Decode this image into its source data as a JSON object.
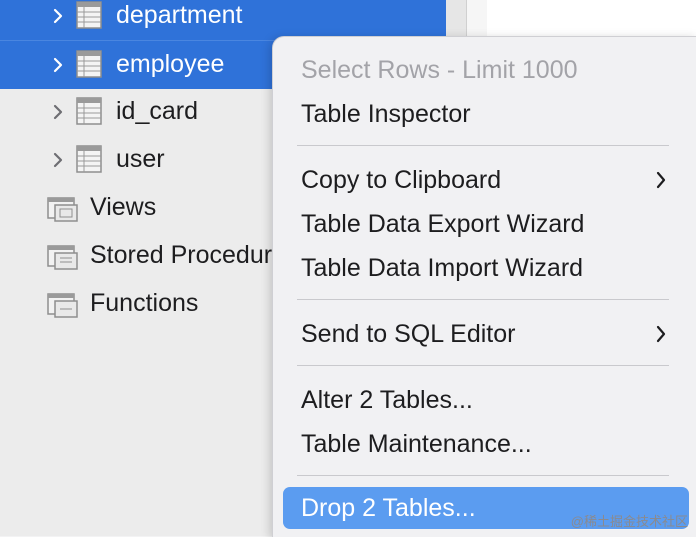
{
  "sidebar": {
    "tables": [
      {
        "label": "department",
        "selected": true
      },
      {
        "label": "employee",
        "selected": true
      },
      {
        "label": "id_card",
        "selected": false
      },
      {
        "label": "user",
        "selected": false
      }
    ],
    "groups": [
      {
        "label": "Views",
        "icon": "views-folder-icon"
      },
      {
        "label": "Stored Procedures",
        "icon": "stored-procedures-folder-icon"
      },
      {
        "label": "Functions",
        "icon": "functions-folder-icon"
      }
    ]
  },
  "context_menu": {
    "items": [
      {
        "label": "Select Rows - Limit 1000",
        "enabled": false
      },
      {
        "label": "Table Inspector",
        "enabled": true
      },
      {
        "label": "Copy to Clipboard",
        "enabled": true,
        "submenu": true
      },
      {
        "label": "Table Data Export Wizard",
        "enabled": true
      },
      {
        "label": "Table Data Import Wizard",
        "enabled": true
      },
      {
        "label": "Send to SQL Editor",
        "enabled": true,
        "submenu": true
      },
      {
        "label": "Alter 2 Tables...",
        "enabled": true
      },
      {
        "label": "Table Maintenance...",
        "enabled": true
      },
      {
        "label": "Drop 2 Tables...",
        "enabled": true,
        "highlighted": true
      }
    ]
  },
  "watermark": "@稀土掘金技术社区",
  "colors": {
    "selection": "#2f72d9",
    "menu_highlight": "#5b9cf0",
    "menu_background": "#f1f1f3",
    "sidebar_background": "#ececec",
    "disabled_text": "#a3a3a8"
  }
}
